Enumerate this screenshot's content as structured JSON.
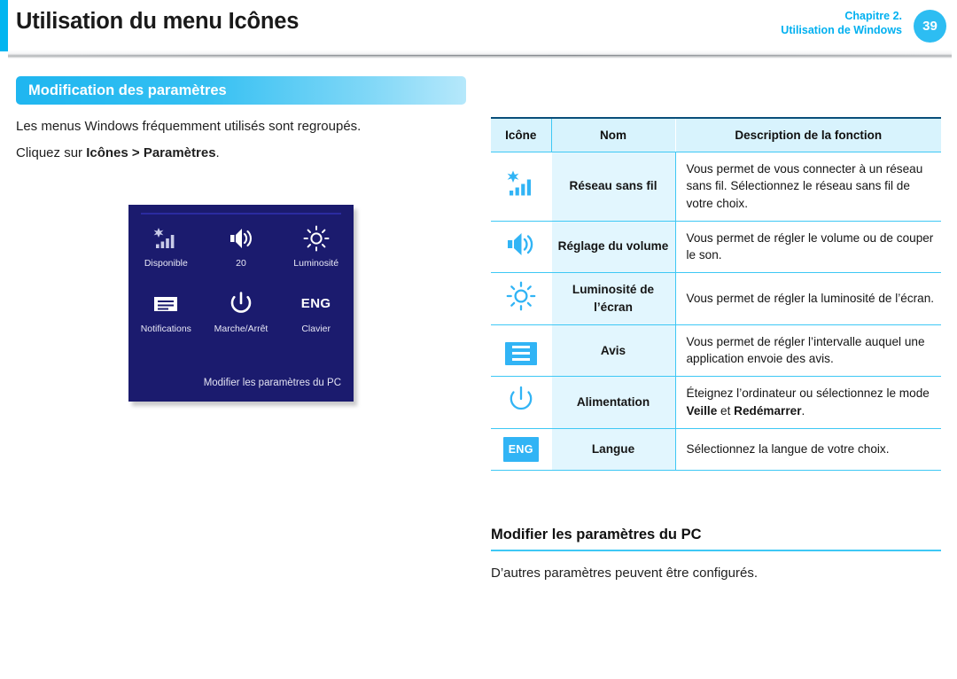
{
  "header": {
    "title": "Utilisation du menu Icônes",
    "chapter": "Chapitre 2.",
    "subtitle": "Utilisation de Windows",
    "page_number": "39",
    "accent_color": "#00b5f0",
    "page_badge_color": "#2dbdf2"
  },
  "left": {
    "section_title": "Modification des paramètres",
    "paragraph_1": "Les menus Windows fréquemment utilisés sont regroupés.",
    "paragraph_2_prefix": "Cliquez sur ",
    "paragraph_2_bold": "Icônes > Paramètres",
    "paragraph_2_suffix": "."
  },
  "charms": {
    "background_color": "#1b1b6e",
    "items": [
      {
        "icon": "wireless-network-icon",
        "label": "Disponible"
      },
      {
        "icon": "volume-speaker-icon",
        "label": "20"
      },
      {
        "icon": "brightness-sun-icon",
        "label": "Luminosité"
      },
      {
        "icon": "notifications-icon",
        "label": "Notifications"
      },
      {
        "icon": "power-icon",
        "label": "Marche/Arrêt"
      },
      {
        "icon": "keyboard-language-icon",
        "label": "Clavier",
        "glyph": "ENG"
      }
    ],
    "footer_link": "Modifier les paramètres du PC"
  },
  "table": {
    "headers": [
      "Icône",
      "Nom",
      "Description de la fonction"
    ],
    "accent_color": "#3ec8f5",
    "name_cell_bg": "#e2f6fe",
    "name_text_color": "#29b6f0",
    "rows": [
      {
        "icon": "wireless-network-icon",
        "name": "Réseau sans fil",
        "description": "Vous permet de vous connecter à un réseau sans fil. Sélectionnez le réseau sans fil de votre choix."
      },
      {
        "icon": "volume-speaker-icon",
        "name": "Réglage du volume",
        "description": "Vous permet de régler le volume ou de couper le son."
      },
      {
        "icon": "brightness-sun-icon",
        "name": "Luminosité de l’écran",
        "description": "Vous permet de régler la luminosité de l’écran."
      },
      {
        "icon": "notifications-icon",
        "name": "Avis",
        "description": "Vous permet de régler l’intervalle auquel une application envoie des avis."
      },
      {
        "icon": "power-icon",
        "name": "Alimentation",
        "description_prefix": "Éteignez l’ordinateur ou sélectionnez le mode ",
        "description_bold_1": "Veille",
        "description_mid": " et ",
        "description_bold_2": "Redémarrer",
        "description_suffix": "."
      },
      {
        "icon": "keyboard-language-icon",
        "glyph": "ENG",
        "name": "Langue",
        "description": "Sélectionnez la langue de votre choix."
      }
    ]
  },
  "subsection": {
    "title": "Modifier les paramètres du PC",
    "body": "D’autres paramètres peuvent être configurés."
  }
}
